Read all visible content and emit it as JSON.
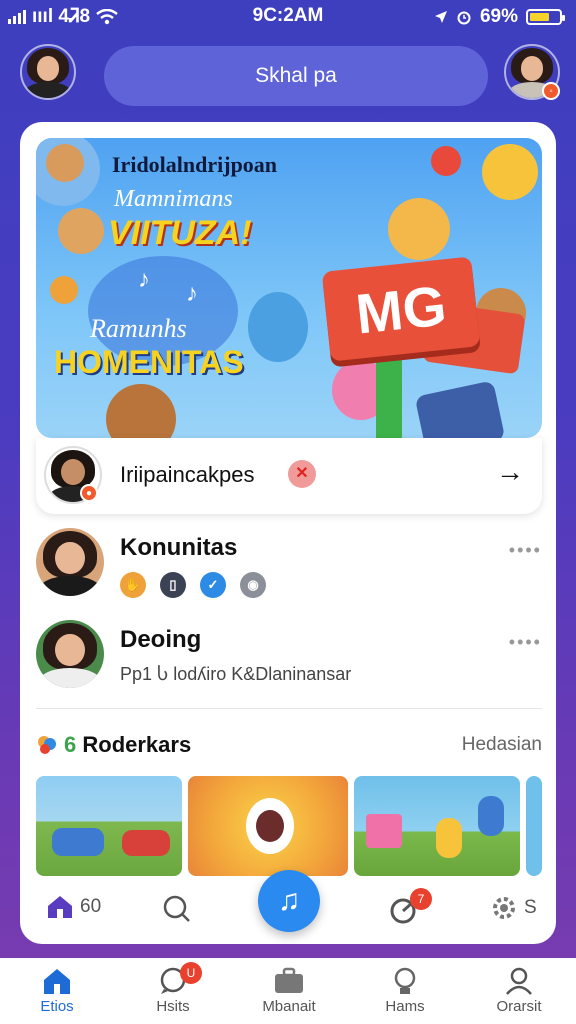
{
  "status": {
    "time": "9C:2AM",
    "carrier": "ıııl 4Ꮨ8",
    "battery": "69%",
    "battery_level": 0.69
  },
  "header": {
    "search_text": "Skhal pa"
  },
  "hero": {
    "title": "Iridolalndrijpoan",
    "subtitle1": "Mamnimans",
    "headline1": "VIITUZA!",
    "subtitle2": "Ramunhs",
    "headline2": "HOMENITAS",
    "sign_text": "MG"
  },
  "profile_bar": {
    "name": "Iriipaincakpes",
    "close_label": "✕",
    "arrow": "→"
  },
  "contacts": [
    {
      "name": "Konunitas",
      "more": "••••"
    },
    {
      "name": "Deoing",
      "subtitle": "Pp1 Ⴑ lodʎiro K&Dlaninansar",
      "more": "••••"
    }
  ],
  "section": {
    "count": "6",
    "title": "Roderkars",
    "link": "Hedasian"
  },
  "actions": {
    "home_count": "60",
    "settings_label": "S",
    "notif_badge": "7"
  },
  "nav": [
    {
      "label": "Etios"
    },
    {
      "label": "Hsits",
      "badge": "U"
    },
    {
      "label": "Mbanait"
    },
    {
      "label": "Hams"
    },
    {
      "label": "Orarsit"
    }
  ],
  "colors": {
    "accent": "#2a8af0",
    "nav_active": "#1f6bd6",
    "badge": "#e8412d"
  }
}
